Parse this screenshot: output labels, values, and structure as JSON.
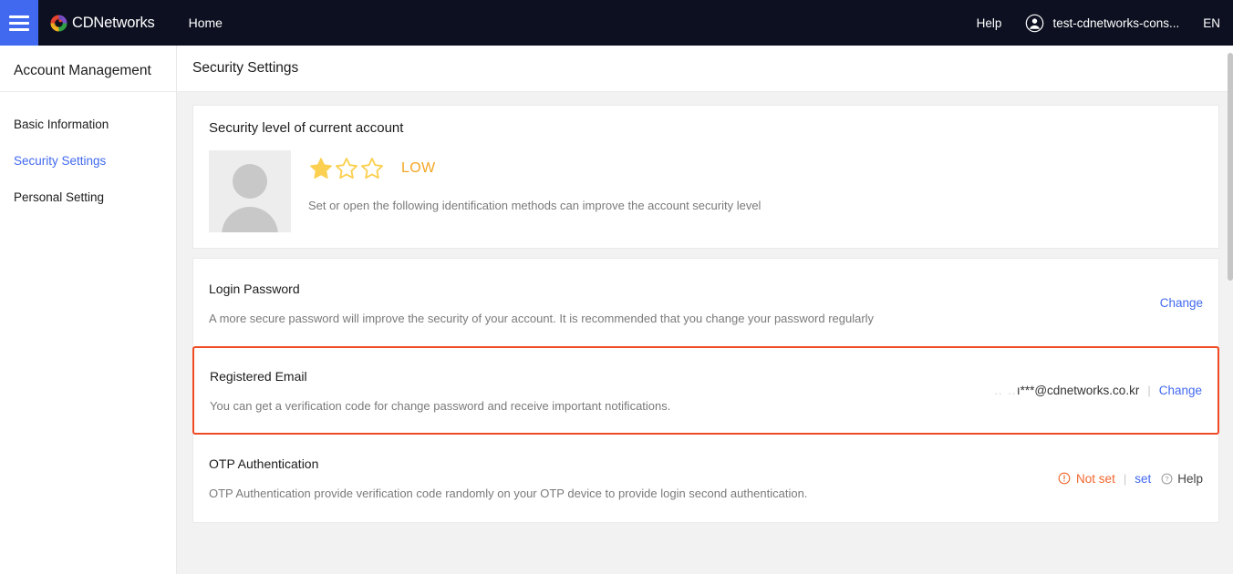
{
  "topbar": {
    "menu_icon": "hamburger-icon",
    "brand_logo_icon": "cdnetworks-logo-icon",
    "brand_name": "CDNetworks",
    "home_label": "Home",
    "help_label": "Help",
    "user_avatar_icon": "user-circle-icon",
    "user_name": "test-cdnetworks-cons...",
    "language_label": "EN",
    "background_color": "#0d1020",
    "menu_button_color": "#4169f0"
  },
  "sidebar": {
    "title": "Account Management",
    "items": [
      {
        "label": "Basic Information",
        "active": false
      },
      {
        "label": "Security Settings",
        "active": true
      },
      {
        "label": "Personal Setting",
        "active": false
      }
    ],
    "active_color": "#4169f0"
  },
  "page": {
    "title": "Security Settings"
  },
  "security_level": {
    "heading": "Security level of current account",
    "avatar_icon": "user-placeholder-avatar",
    "stars_total": 3,
    "stars_filled": 1,
    "star_color": "#fbd050",
    "level_label": "LOW",
    "level_color": "#f5a623",
    "hint": "Set or open the following identification methods can improve the account security level"
  },
  "methods": [
    {
      "name": "Login Password",
      "description": "A more secure password will improve the security of your account. It is recommended that you change your password regularly",
      "highlighted": false,
      "value_faint": "",
      "value": "",
      "status": "",
      "actions": [
        {
          "label": "Change",
          "type": "link"
        }
      ]
    },
    {
      "name": "Registered Email",
      "description": "You can get a verification code for change password and receive important notifications.",
      "highlighted": true,
      "highlight_color": "#f04a23",
      "value_faint": "‥   ‥",
      "value": "ı***@cdnetworks.co.kr",
      "status": "",
      "actions": [
        {
          "label": "Change",
          "type": "link"
        }
      ]
    },
    {
      "name": "OTP Authentication",
      "description": "OTP Authentication provide verification code randomly on your OTP device to provide login second authentication.",
      "highlighted": false,
      "value_faint": "",
      "value": "",
      "status": "Not set",
      "status_icon": "warning-circle-icon",
      "status_color": "#f0662b",
      "actions": [
        {
          "label": "set",
          "type": "link"
        },
        {
          "label": "Help",
          "type": "help",
          "icon": "question-circle-icon"
        }
      ]
    }
  ],
  "separators": {
    "pipe": "|"
  }
}
